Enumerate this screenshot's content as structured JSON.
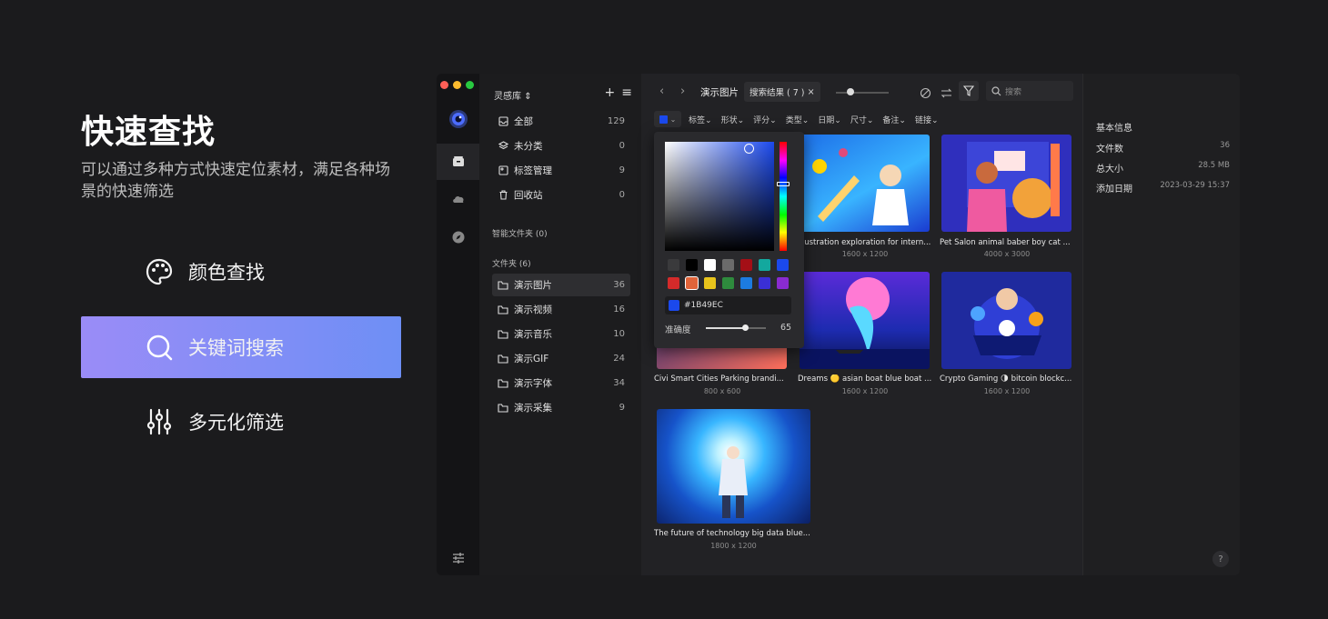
{
  "hero": {
    "title": "快速查找",
    "subtitle": "可以通过多种方式快速定位素材，满足各种场景的快速筛选"
  },
  "features": [
    {
      "label": "颜色查找",
      "icon": "palette-icon"
    },
    {
      "label": "关键词搜索",
      "icon": "search-icon"
    },
    {
      "label": "多元化筛选",
      "icon": "sliders-icon"
    }
  ],
  "colors": {
    "accent": "#1b49ec",
    "feature_active_start": "#9a8cf7",
    "feature_active_end": "#6e8ff5"
  },
  "app": {
    "library": {
      "name": "灵感库",
      "items": [
        {
          "label": "全部",
          "count": "129",
          "icon": "inbox-icon"
        },
        {
          "label": "未分类",
          "count": "0",
          "icon": "layers-icon"
        },
        {
          "label": "标签管理",
          "count": "9",
          "icon": "tag-icon"
        },
        {
          "label": "回收站",
          "count": "0",
          "icon": "trash-icon"
        }
      ]
    },
    "smart_folders_title": "智能文件夹 (0)",
    "folders_title": "文件夹 (6)",
    "folders": [
      {
        "label": "演示图片",
        "count": "36"
      },
      {
        "label": "演示视频",
        "count": "16"
      },
      {
        "label": "演示音乐",
        "count": "10"
      },
      {
        "label": "演示GIF",
        "count": "24"
      },
      {
        "label": "演示字体",
        "count": "34"
      },
      {
        "label": "演示采集",
        "count": "9"
      }
    ],
    "toolbar": {
      "crumb": "演示图片",
      "search_tag": "搜索结果 ( 7 )",
      "close": "×",
      "search_placeholder": "搜索"
    },
    "filters": [
      "标签",
      "形状",
      "评分",
      "类型",
      "日期",
      "尺寸",
      "备注",
      "链接"
    ],
    "items": [
      {
        "caption": "Civi Smart Cities Parking brandi...",
        "size": "800 x 600"
      },
      {
        "caption": "Illustration exploration for intern...",
        "size": "1600 x 1200"
      },
      {
        "caption": "Pet Salon animal baber boy cat ...",
        "size": "4000 x 3000"
      },
      {
        "caption": "Dreams 🟡 asian boat blue boat ...",
        "size": "1600 x 1200"
      },
      {
        "caption": "Crypto Gaming 🌗 bitcoin blockc...",
        "size": "1600 x 1200"
      },
      {
        "caption": "The future of technology big data blue...",
        "size": "1800 x 1200"
      }
    ],
    "picker": {
      "hex": "#1B49EC",
      "accuracy_label": "准确度",
      "accuracy_value": "65",
      "accuracy_fraction": 0.65,
      "swatches": [
        "#3a3a3c",
        "#000000",
        "#ffffff",
        "#6b6b6b",
        "#a40f16",
        "#13a89e",
        "#1b49ec",
        "#d42a2a",
        "#e0643a",
        "#e8c41c",
        "#2e8b3d",
        "#1c7be0",
        "#3a2fd6",
        "#8a2bd0"
      ]
    },
    "info": {
      "title": "基本信息",
      "rows": [
        {
          "label": "文件数",
          "value": "36"
        },
        {
          "label": "总大小",
          "value": "28.5 MB"
        },
        {
          "label": "添加日期",
          "value": "2023-03-29 15:37"
        }
      ],
      "help": "?"
    }
  }
}
